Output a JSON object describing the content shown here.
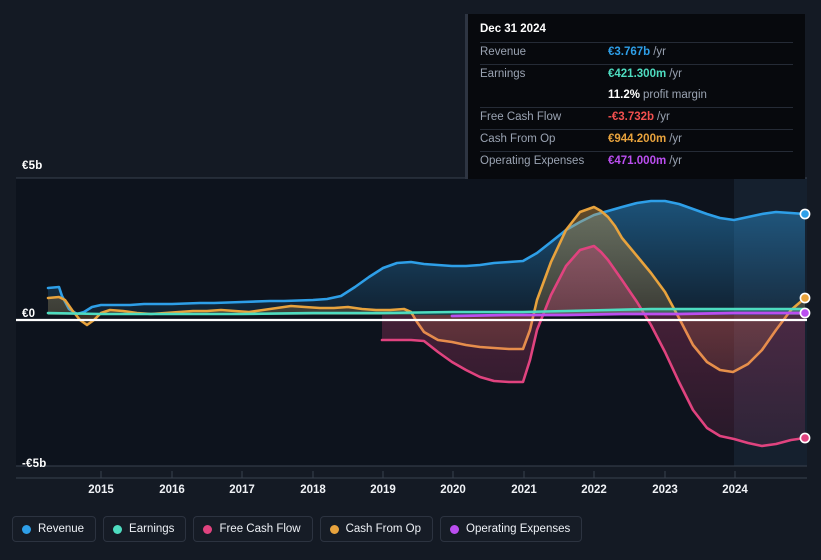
{
  "tooltip": {
    "date": "Dec 31 2024",
    "rows": [
      {
        "label": "Revenue",
        "value": "€3.767b",
        "unit": "/yr",
        "color": "#2e9fe8"
      },
      {
        "label": "Earnings",
        "value": "€421.300m",
        "unit": "/yr",
        "color": "#4edcc0"
      },
      {
        "label": "",
        "value": "11.2%",
        "unit": "profit margin",
        "color": "#ffffff"
      },
      {
        "label": "Free Cash Flow",
        "value": "-€3.732b",
        "unit": "/yr",
        "color": "#f2504f"
      },
      {
        "label": "Cash From Op",
        "value": "€944.200m",
        "unit": "/yr",
        "color": "#e8a33d"
      },
      {
        "label": "Operating Expenses",
        "value": "€471.000m",
        "unit": "/yr",
        "color": "#bb4ef0"
      }
    ]
  },
  "legend": {
    "items": [
      {
        "label": "Revenue",
        "color": "#2e9fe8"
      },
      {
        "label": "Earnings",
        "color": "#4edcc0"
      },
      {
        "label": "Free Cash Flow",
        "color": "#e0437f"
      },
      {
        "label": "Cash From Op",
        "color": "#e8a33d"
      },
      {
        "label": "Operating Expenses",
        "color": "#bb4ef0"
      }
    ]
  },
  "axes": {
    "y_ticks": [
      "€5b",
      "€0",
      "-€5b"
    ],
    "x_ticks": [
      "2015",
      "2016",
      "2017",
      "2018",
      "2019",
      "2020",
      "2021",
      "2022",
      "2023",
      "2024"
    ]
  },
  "chart_data": {
    "type": "area",
    "title": "",
    "xlabel": "",
    "ylabel": "",
    "ylim": [
      -5,
      5
    ],
    "y_unit": "EUR billions",
    "grid": false,
    "legend_position": "bottom",
    "forecast_start": "2024.15",
    "x": [
      2014.3,
      2014.9,
      2015.0,
      2015.4,
      2015.9,
      2016.4,
      2017.0,
      2017.5,
      2018.0,
      2018.5,
      2019.0,
      2019.5,
      2020.0,
      2020.5,
      2021.0,
      2021.5,
      2022.0,
      2022.5,
      2023.0,
      2023.5,
      2024.0,
      2024.5,
      2025.0
    ],
    "series": [
      {
        "name": "Revenue",
        "color": "#2e9fe8",
        "values": [
          0.92,
          0.93,
          0.4,
          0.53,
          0.56,
          0.55,
          0.56,
          0.58,
          0.58,
          0.62,
          0.95,
          1.33,
          1.45,
          1.36,
          1.33,
          1.45,
          2.1,
          2.85,
          3.55,
          3.62,
          3.3,
          3.58,
          3.767
        ]
      },
      {
        "name": "Earnings",
        "color": "#4edcc0",
        "values": [
          0.06,
          0.06,
          0.05,
          0.06,
          0.06,
          0.06,
          0.06,
          0.06,
          0.06,
          0.07,
          0.08,
          0.1,
          0.11,
          0.1,
          0.1,
          0.12,
          0.2,
          0.28,
          0.34,
          0.36,
          0.38,
          0.4,
          0.4213
        ]
      },
      {
        "name": "Free Cash Flow",
        "color": "#e0437f",
        "values": [
          null,
          null,
          null,
          null,
          null,
          null,
          null,
          null,
          null,
          null,
          -0.85,
          -0.88,
          -1.3,
          -1.9,
          -2.1,
          -2.1,
          2.35,
          1.55,
          -1.2,
          -3.35,
          -4.35,
          -4.45,
          -3.732
        ]
      },
      {
        "name": "Cash From Op",
        "color": "#e8a33d",
        "values": [
          0.56,
          0.52,
          -0.08,
          0.16,
          0.1,
          0.12,
          0.22,
          0.2,
          0.21,
          0.27,
          0.2,
          0.24,
          -0.7,
          -0.98,
          -1.05,
          -0.32,
          3.65,
          2.6,
          0.55,
          -1.18,
          -1.92,
          -1.1,
          0.9442
        ]
      },
      {
        "name": "Operating Expenses",
        "color": "#bb4ef0",
        "values": [
          null,
          null,
          null,
          null,
          null,
          null,
          null,
          null,
          null,
          null,
          null,
          null,
          0.2,
          0.22,
          0.25,
          0.27,
          0.29,
          0.31,
          0.34,
          0.37,
          0.4,
          0.44,
          0.471
        ]
      }
    ]
  }
}
